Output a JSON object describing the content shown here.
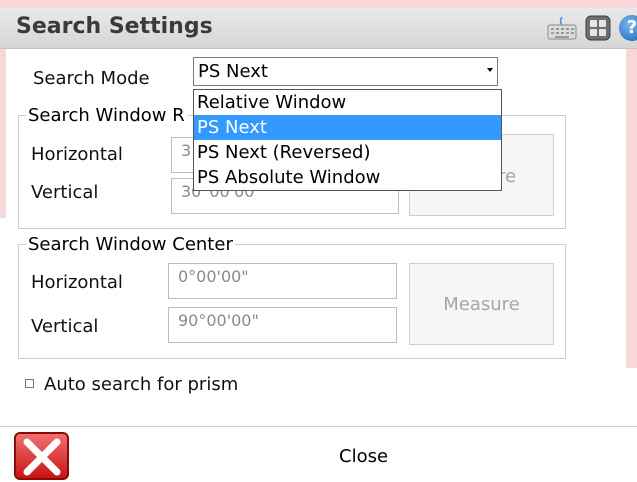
{
  "window": {
    "title": "Search Settings"
  },
  "titlebar_icons": [
    "keyboard-icon",
    "calculator-icon",
    "help-icon"
  ],
  "search_mode": {
    "label": "Search Mode",
    "selected": "PS Next",
    "options": [
      "Relative Window",
      "PS Next",
      "PS Next (Reversed)",
      "PS Absolute Window"
    ],
    "highlighted_option": "PS Next"
  },
  "search_window_range": {
    "group_label": "Search Window R",
    "horizontal_label": "Horizontal",
    "vertical_label": "Vertical",
    "horizontal_value": "3",
    "vertical_value": "30°00'00\"",
    "measure_label": "re"
  },
  "search_window_center": {
    "group_label": "Search Window Center",
    "horizontal_label": "Horizontal",
    "vertical_label": "Vertical",
    "horizontal_value": "0°00'00\"",
    "vertical_value": "90°00'00\"",
    "measure_label": "Measure"
  },
  "auto_search": {
    "label": "Auto search for prism",
    "checked": false
  },
  "footer": {
    "close_label": "Close"
  },
  "colors": {
    "highlight": "#3399ff",
    "close_red": "#c81414"
  }
}
